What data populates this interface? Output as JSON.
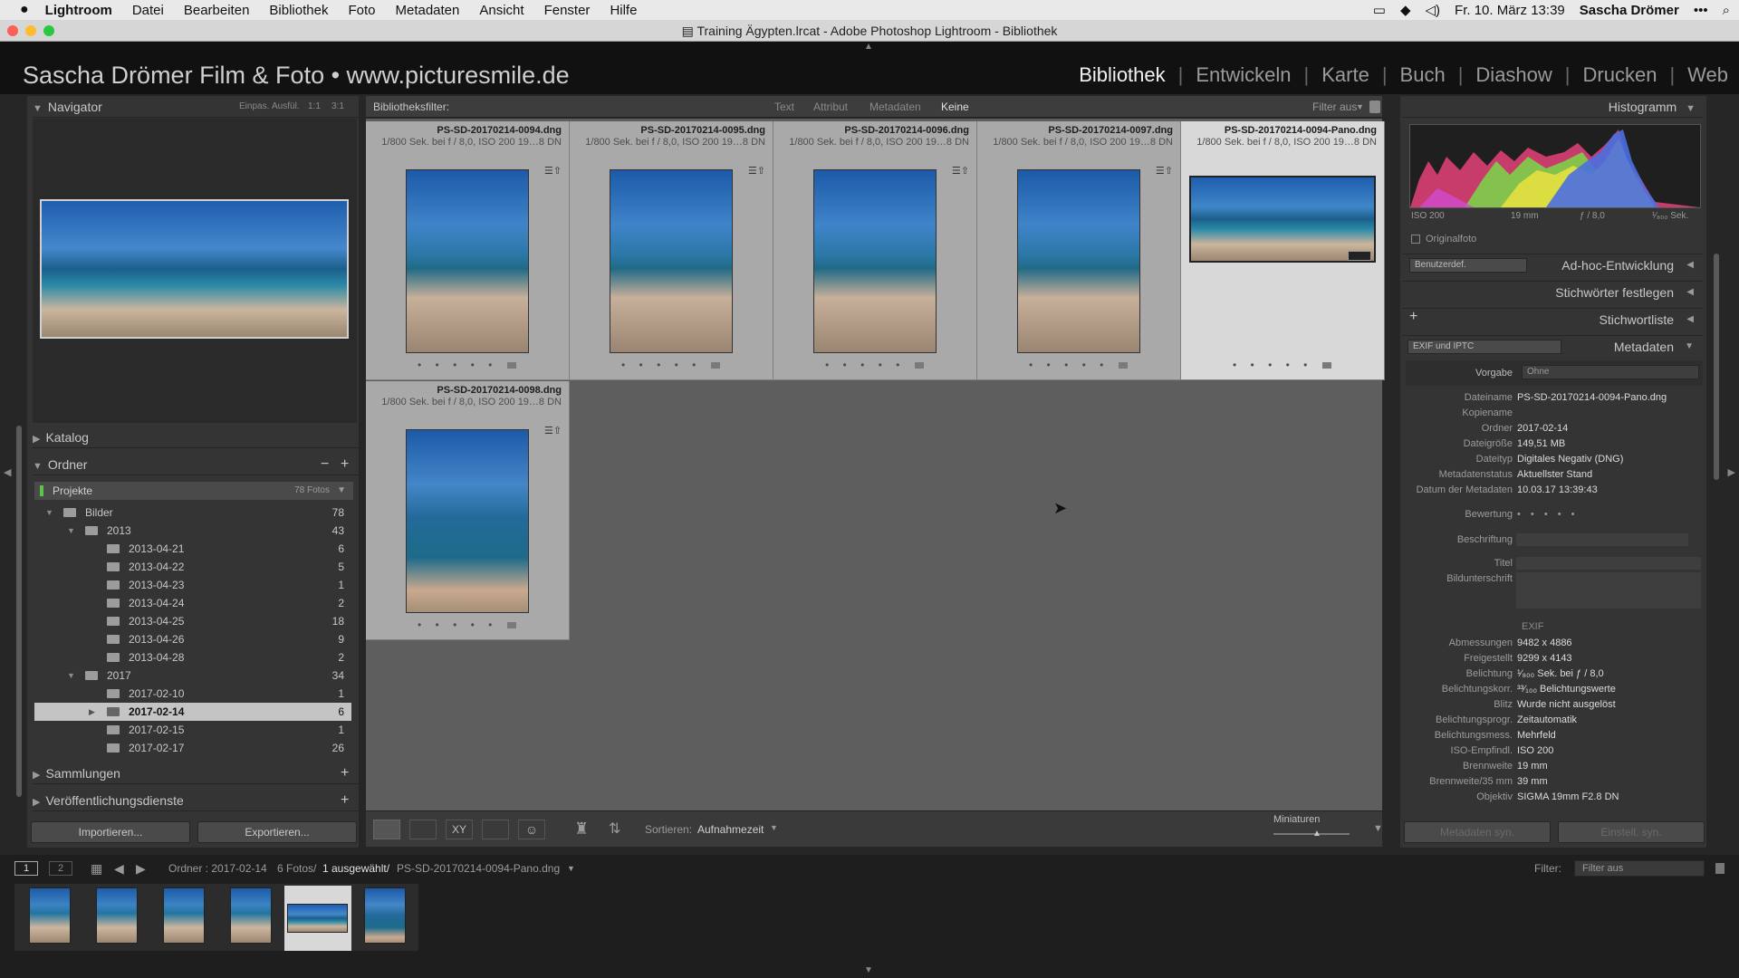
{
  "menubar": {
    "app": "Lightroom",
    "items": [
      "Datei",
      "Bearbeiten",
      "Bibliothek",
      "Foto",
      "Metadaten",
      "Ansicht",
      "Fenster",
      "Hilfe"
    ],
    "datetime": "Fr. 10. März  13:39",
    "user": "Sascha Drömer"
  },
  "window": {
    "title": "Training Ägypten.lrcat - Adobe Photoshop Lightroom - Bibliothek"
  },
  "identity": "Sascha Drömer Film & Foto • www.picturesmile.de",
  "modules": [
    "Bibliothek",
    "Entwickeln",
    "Karte",
    "Buch",
    "Diashow",
    "Drucken",
    "Web"
  ],
  "left": {
    "navigator": {
      "title": "Navigator",
      "zoom": [
        "Einpas.",
        "Ausfül.",
        "1:1",
        "3:1"
      ]
    },
    "katalog": "Katalog",
    "ordner": "Ordner",
    "volume": {
      "name": "Projekte",
      "count": "78 Fotos"
    },
    "folders": [
      {
        "name": "Bilder",
        "count": "78"
      },
      {
        "name": "2013",
        "count": "43"
      },
      {
        "name": "2013-04-21",
        "count": "6"
      },
      {
        "name": "2013-04-22",
        "count": "5"
      },
      {
        "name": "2013-04-23",
        "count": "1"
      },
      {
        "name": "2013-04-24",
        "count": "2"
      },
      {
        "name": "2013-04-25",
        "count": "18"
      },
      {
        "name": "2013-04-26",
        "count": "9"
      },
      {
        "name": "2013-04-28",
        "count": "2"
      },
      {
        "name": "2017",
        "count": "34"
      },
      {
        "name": "2017-02-10",
        "count": "1"
      },
      {
        "name": "2017-02-14",
        "count": "6"
      },
      {
        "name": "2017-02-15",
        "count": "1"
      },
      {
        "name": "2017-02-17",
        "count": "26"
      }
    ],
    "sammlungen": "Sammlungen",
    "veroeff": "Veröffentlichungsdienste",
    "import_label": "Importieren...",
    "export_label": "Exportieren..."
  },
  "filterbar": {
    "label": "Bibliotheksfilter:",
    "options": [
      "Text",
      "Attribut",
      "Metadaten",
      "Keine"
    ],
    "filter_state": "Filter aus"
  },
  "grid": {
    "cells": [
      {
        "file": "PS-SD-20170214-0094.dng",
        "exif": "1/800 Sek. bei f / 8,0, ISO 200     19…8 DN"
      },
      {
        "file": "PS-SD-20170214-0095.dng",
        "exif": "1/800 Sek. bei f / 8,0, ISO 200     19…8 DN"
      },
      {
        "file": "PS-SD-20170214-0096.dng",
        "exif": "1/800 Sek. bei f / 8,0, ISO 200     19…8 DN"
      },
      {
        "file": "PS-SD-20170214-0097.dng",
        "exif": "1/800 Sek. bei f / 8,0, ISO 200     19…8 DN"
      },
      {
        "file": "PS-SD-20170214-0094-Pano.dng",
        "exif": "1/800 Sek. bei f / 8,0, ISO 200     19…8 DN"
      },
      {
        "file": "PS-SD-20170214-0098.dng",
        "exif": "1/800 Sek. bei f / 8,0, ISO 200     19…8 DN"
      }
    ],
    "stars": "• • • • •"
  },
  "toolbar": {
    "sort_label": "Sortieren:",
    "sort_value": "Aufnahmezeit",
    "thumbs_label": "Miniaturen"
  },
  "right": {
    "histogram": {
      "title": "Histogramm",
      "iso": "ISO 200",
      "focal": "19 mm",
      "aperture": "ƒ / 8,0",
      "shutter": "¹⁄₈₀₀ Sek.",
      "original": "Originalfoto"
    },
    "quickdev": {
      "preset": "Benutzerdef.",
      "title": "Ad-hoc-Entwicklung"
    },
    "keywording": "Stichwörter festlegen",
    "keywordlist": "Stichwortliste",
    "metadata": {
      "preset_select": "EXIF und IPTC",
      "title": "Metadaten",
      "vorgabe_label": "Vorgabe",
      "vorgabe_value": "Ohne",
      "rows": [
        {
          "k": "Dateiname",
          "v": "PS-SD-20170214-0094-Pano.dng"
        },
        {
          "k": "Kopiename",
          "v": ""
        },
        {
          "k": "Ordner",
          "v": "2017-02-14"
        },
        {
          "k": "Dateigröße",
          "v": "149,51 MB"
        },
        {
          "k": "Dateityp",
          "v": "Digitales Negativ (DNG)"
        },
        {
          "k": "Metadatenstatus",
          "v": "Aktuellster Stand"
        },
        {
          "k": "Datum der Metadaten",
          "v": "10.03.17 13:39:43"
        }
      ],
      "bewertung_label": "Bewertung",
      "bewertung_value": "• • • • •",
      "beschriftung_label": "Beschriftung",
      "titel_label": "Titel",
      "bildunterschrift_label": "Bildunterschrift",
      "exif_label": "EXIF",
      "exif_rows": [
        {
          "k": "Abmessungen",
          "v": "9482 x 4886"
        },
        {
          "k": "Freigestellt",
          "v": "9299 x 4143"
        },
        {
          "k": "Belichtung",
          "v": "¹⁄₈₀₀ Sek. bei ƒ / 8,0"
        },
        {
          "k": "Belichtungskorr.",
          "v": "³³⁄₁₀₀ Belichtungswerte"
        },
        {
          "k": "Blitz",
          "v": "Wurde nicht ausgelöst"
        },
        {
          "k": "Belichtungsprogr.",
          "v": "Zeitautomatik"
        },
        {
          "k": "Belichtungsmess.",
          "v": "Mehrfeld"
        },
        {
          "k": "ISO-Empfindl.",
          "v": "ISO 200"
        },
        {
          "k": "Brennweite",
          "v": "19 mm"
        },
        {
          "k": "Brennweite/35 mm",
          "v": "39 mm"
        },
        {
          "k": "Objektiv",
          "v": "SIGMA 19mm F2.8 DN"
        }
      ]
    },
    "sync_meta": "Metadaten syn.",
    "sync_settings": "Einstell. syn."
  },
  "filmstrip": {
    "screen1": "1",
    "screen2": "2",
    "path_prefix": "Ordner : 2017-02-14",
    "count": "6 Fotos/",
    "selected": "1 ausgewählt/",
    "file": "PS-SD-20170214-0094-Pano.dng",
    "filter_label": "Filter:",
    "filter_value": "Filter aus"
  },
  "colors": {
    "accent": "#f2f2f2",
    "panel": "#343434",
    "grid_bg": "#5e5e5e"
  }
}
